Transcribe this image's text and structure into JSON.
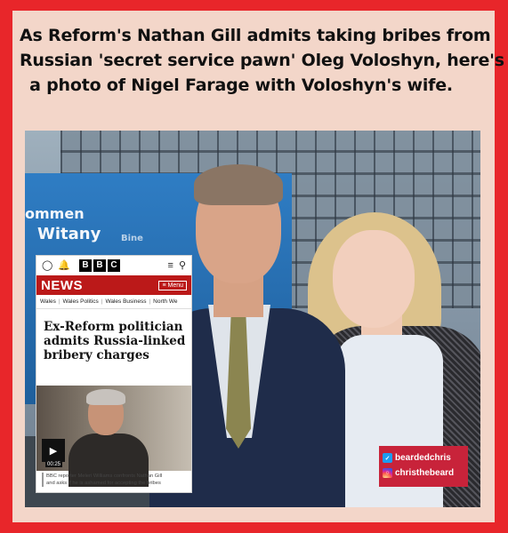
{
  "caption": {
    "line1": "As Reform's Nathan Gill admits taking bribes from",
    "line2": "Russian 'secret service pawn' Oleg Voloshyn, here's",
    "line3": "a photo of Nigel Farage with Voloshyn's wife."
  },
  "photo": {
    "bus_text_1": "ommen",
    "bus_text_2": "Witany",
    "bus_text_3": "Bine"
  },
  "bbc_card": {
    "logo_letters": [
      "B",
      "B",
      "C"
    ],
    "news_label": "NEWS",
    "menu_label": "Menu",
    "nav_items": [
      "Wales",
      "Wales Politics",
      "Wales Business",
      "North We"
    ],
    "headline_line1": "Ex-Reform politician",
    "headline_line2": "admits Russia-linked",
    "headline_line3": "bribery charges",
    "video_duration": "00:25",
    "image_caption_line1": "BBC reporter Meleri Williams confronts Nathan Gill",
    "image_caption_line2": "and asks if he is ashamed for accepting the bribes",
    "icons": [
      "account-icon",
      "bell-icon",
      "menu-icon",
      "search-icon",
      "play-icon"
    ]
  },
  "social": {
    "twitter_handle": "beardedchris",
    "instagram_handle": "christhebeard"
  },
  "colors": {
    "frame_red": "#e8262a",
    "inner_bg": "#f3d6c9",
    "bbc_red": "#bb1919",
    "badge_red": "#c8233a"
  }
}
